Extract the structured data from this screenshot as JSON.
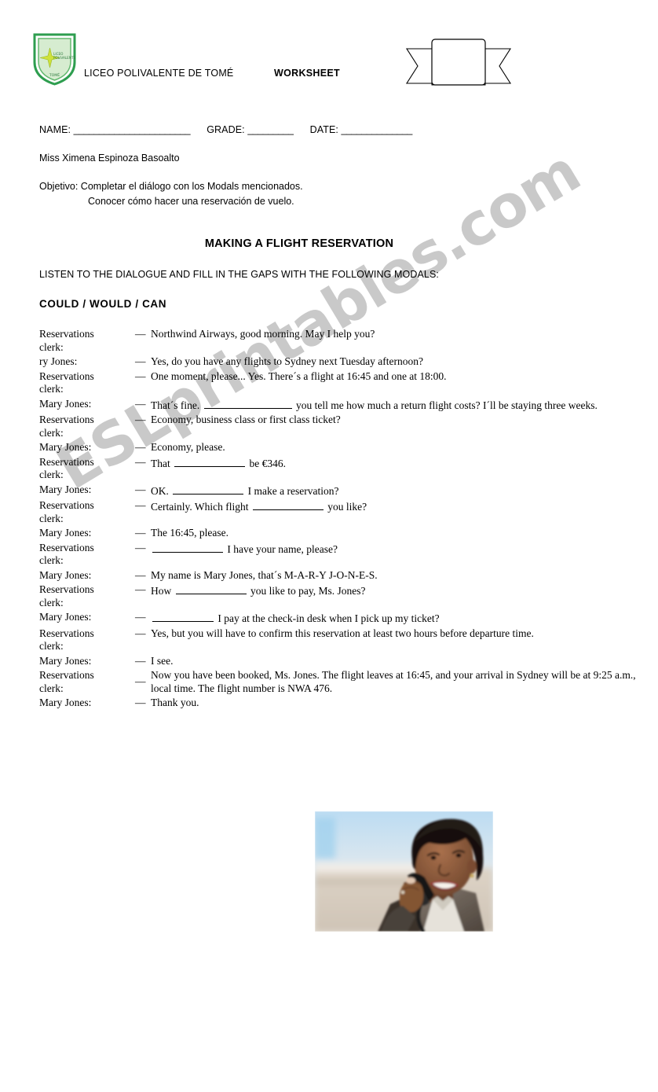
{
  "document": {
    "type": "esl-worksheet",
    "watermark": "ESLprintables.com",
    "watermark_color": "#c9c9c9"
  },
  "header": {
    "school_name": "LICEO POLIVALENTE DE TOMÉ",
    "worksheet_label": "WORKSHEET",
    "crest": {
      "icon": "school-crest-shield-icon",
      "shield_color": "#2e9e4f",
      "field_color": "#cfe8c9",
      "text_top": "LICEO POLIVALENTE",
      "text_bottom": "TOMÉ"
    },
    "ribbon": {
      "icon": "ribbon-banner-shape",
      "label": ""
    }
  },
  "meta": {
    "name_label": "NAME:",
    "name_blank": "_______________________",
    "grade_label": "GRADE:",
    "grade_blank": "_________",
    "date_label": "DATE:",
    "date_blank": "______________",
    "teacher": "Miss Ximena Espinoza Basoalto",
    "objective_line1": "Objetivo: Completar el diálogo con los Modals mencionados.",
    "objective_line2": "Conocer  cómo hacer una reservación de vuelo."
  },
  "lesson": {
    "title": "MAKING  A FLIGHT RESERVATION",
    "instructions": "LISTEN TO THE DIALOGUE AND FILL IN THE GAPS WITH THE FOLLOWING MODALS:",
    "modals": "COULD  /  WOULD  /  CAN"
  },
  "dialogue": {
    "turns": [
      {
        "speaker_line1": "Reservations",
        "speaker_line2": "clerk:",
        "dash": "—",
        "parts": [
          {
            "kind": "text",
            "value": "Northwind Airways, good morning. May I help you?"
          }
        ]
      },
      {
        "speaker_line1": "ry Jones:",
        "speaker_line2": "",
        "dash": "—",
        "parts": [
          {
            "kind": "text",
            "value": "Yes, do you have any flights to Sydney next Tuesday afternoon?"
          }
        ]
      },
      {
        "speaker_line1": "Reservations",
        "speaker_line2": "clerk:",
        "dash": "—",
        "parts": [
          {
            "kind": "text",
            "value": "One moment, please... Yes. There´s a flight at 16:45 and one at 18:00."
          }
        ]
      },
      {
        "speaker_line1": "Mary Jones:",
        "speaker_line2": "",
        "dash": "—",
        "parts": [
          {
            "kind": "text",
            "value": "That´s fine. "
          },
          {
            "kind": "blank",
            "size": "lg"
          },
          {
            "kind": "text",
            "value": " you tell me how much a return flight costs? I´ll be staying three weeks."
          }
        ]
      },
      {
        "speaker_line1": "Reservations",
        "speaker_line2": "clerk:",
        "dash": "—",
        "parts": [
          {
            "kind": "text",
            "value": "Economy, business class or first class ticket?"
          }
        ]
      },
      {
        "speaker_line1": "Mary Jones:",
        "speaker_line2": "",
        "dash": "—",
        "parts": [
          {
            "kind": "text",
            "value": "Economy, please."
          }
        ]
      },
      {
        "speaker_line1": "Reservations",
        "speaker_line2": "clerk:",
        "dash": "—",
        "parts": [
          {
            "kind": "text",
            "value": "That "
          },
          {
            "kind": "blank",
            "size": "md"
          },
          {
            "kind": "text",
            "value": " be €346."
          }
        ]
      },
      {
        "speaker_line1": "Mary Jones:",
        "speaker_line2": "",
        "dash": "—",
        "parts": [
          {
            "kind": "text",
            "value": "OK. "
          },
          {
            "kind": "blank",
            "size": "md"
          },
          {
            "kind": "text",
            "value": " I make a reservation?"
          }
        ]
      },
      {
        "speaker_line1": "Reservations",
        "speaker_line2": "clerk:",
        "dash": "—",
        "parts": [
          {
            "kind": "text",
            "value": "Certainly. Which flight "
          },
          {
            "kind": "blank",
            "size": "md"
          },
          {
            "kind": "text",
            "value": " you like?"
          }
        ]
      },
      {
        "speaker_line1": "Mary Jones:",
        "speaker_line2": "",
        "dash": "—",
        "parts": [
          {
            "kind": "text",
            "value": "The 16:45, please."
          }
        ]
      },
      {
        "speaker_line1": "Reservations",
        "speaker_line2": "clerk:",
        "dash": "—",
        "parts": [
          {
            "kind": "blank",
            "size": "md"
          },
          {
            "kind": "text",
            "value": " I have your name, please?"
          }
        ]
      },
      {
        "speaker_line1": "Mary Jones:",
        "speaker_line2": "",
        "dash": "—",
        "parts": [
          {
            "kind": "text",
            "value": "My name is Mary Jones, that´s M-A-R-Y J-O-N-E-S."
          }
        ]
      },
      {
        "speaker_line1": "Reservations",
        "speaker_line2": "clerk:",
        "dash": "—",
        "parts": [
          {
            "kind": "text",
            "value": "How "
          },
          {
            "kind": "blank",
            "size": "md"
          },
          {
            "kind": "text",
            "value": " you like to pay, Ms. Jones?"
          }
        ]
      },
      {
        "speaker_line1": "Mary Jones:",
        "speaker_line2": "",
        "dash": "—",
        "parts": [
          {
            "kind": "blank",
            "size": "sm"
          },
          {
            "kind": "text",
            "value": " I pay at the check-in desk when I pick up my ticket?"
          }
        ]
      },
      {
        "speaker_line1": "Reservations",
        "speaker_line2": "clerk:",
        "dash": "—",
        "parts": [
          {
            "kind": "text",
            "value": "Yes, but you will have to confirm this reservation at least two hours before departure time."
          }
        ]
      },
      {
        "speaker_line1": "Mary Jones:",
        "speaker_line2": "",
        "dash": "—",
        "parts": [
          {
            "kind": "text",
            "value": "I see."
          }
        ]
      },
      {
        "speaker_line1": "Reservations",
        "speaker_line2": "clerk:",
        "dash": "—",
        "parts": [
          {
            "kind": "text",
            "value": "Now you have been booked, Ms. Jones. The flight leaves at 16:45, and your arrival in Sydney will be at 9:25 a.m., local time. The flight number is NWA 476."
          }
        ]
      },
      {
        "speaker_line1": "Mary Jones:",
        "speaker_line2": "",
        "dash": "—",
        "parts": [
          {
            "kind": "text",
            "value": "Thank you."
          }
        ]
      }
    ]
  },
  "photo": {
    "name": "woman-on-telephone-photo",
    "description": "Smiling woman holding a telephone handset, blurred pale blue and beige background",
    "sky_color": "#cfe2ef",
    "ground_color": "#d8cfc4",
    "skin_color": "#8a5a3c",
    "hair_color": "#1a1210",
    "jacket_color": "#6b5f55"
  }
}
